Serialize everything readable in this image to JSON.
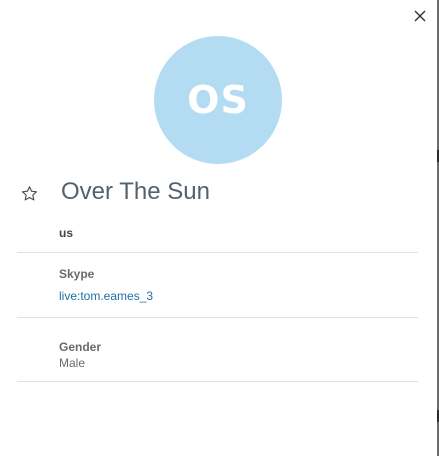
{
  "contact": {
    "initials": "OS",
    "name": "Over The Sun",
    "subtitle": "us",
    "avatar_color": "#b3dcf3"
  },
  "fields": {
    "skype": {
      "label": "Skype",
      "value": "live:tom.eames_3"
    },
    "gender": {
      "label": "Gender",
      "value": "Male"
    }
  },
  "icons": {
    "close": "close-icon",
    "favorite": "star-outline-icon"
  }
}
